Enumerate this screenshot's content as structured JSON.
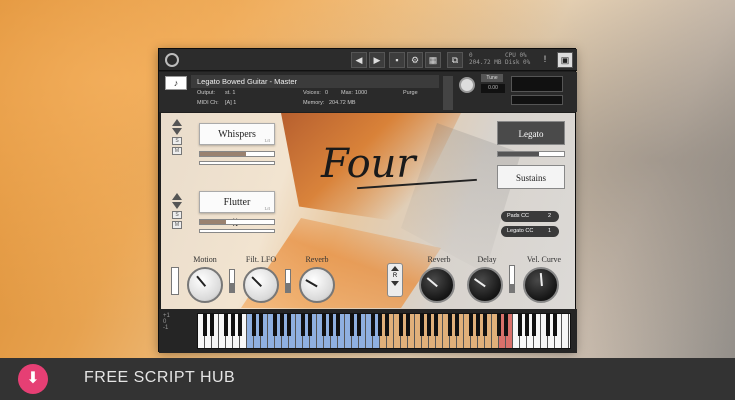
{
  "topbar": {
    "stats": {
      "voices": "0",
      "memory": "204.72 MB",
      "cpu": "CPU 0%",
      "disk": "Disk 0%"
    },
    "buttons": [
      "◀",
      "▶",
      "💾",
      "⚙",
      "▦",
      "⧉",
      "!",
      "▣"
    ]
  },
  "header": {
    "instrument_name": "Legato Bowed Guitar - Master",
    "output_label": "Output: ",
    "output_value": "st. 1",
    "voices_label": "Voices:",
    "voices_value": "0",
    "max_label": "Max:",
    "max_value": "1000",
    "purge_label": "Purge",
    "midi_label": "MIDI Ch:",
    "midi_value": "[A] 1",
    "memory_label": "Memory:",
    "memory_value": "204.72 MB",
    "tune_label": "Tune",
    "tune_value": "0.00"
  },
  "layers": {
    "layer1": {
      "name": "Whispers",
      "sub": "Lfl",
      "side_label": "Select",
      "fill": 0.62
    },
    "layer2": {
      "name": "Flutter",
      "sub": "Lfl",
      "side_label": "Select",
      "fill": 0.35
    },
    "swap_icon": "⇅"
  },
  "logo": "Four",
  "right_controls": {
    "legato_label": "Legato",
    "sustains_label": "Sustains",
    "pads_cc_label": "Pads CC",
    "pads_cc_value": "2",
    "legato_cc_label": "Legato CC",
    "legato_cc_value": "1",
    "level_fill": 0.62
  },
  "knobs_left": [
    {
      "label": "Motion"
    },
    {
      "label": "Filt. LFO"
    },
    {
      "label": "Reverb"
    }
  ],
  "knobs_right": [
    {
      "label": "Reverb"
    },
    {
      "label": "Delay"
    },
    {
      "label": "Vel. Curve"
    }
  ],
  "r_button": "R",
  "keyboard": {
    "side_labels": [
      "+1",
      "0",
      "-1"
    ]
  },
  "banner": {
    "text": "FREE SCRIPT HUB",
    "icon": "download-icon"
  },
  "colors": {
    "banner_bg": "#333333",
    "banner_icon": "#e63f74",
    "key_blue": "#8fb0e0",
    "key_tan": "#e0b07a",
    "key_red": "#d9706a"
  }
}
